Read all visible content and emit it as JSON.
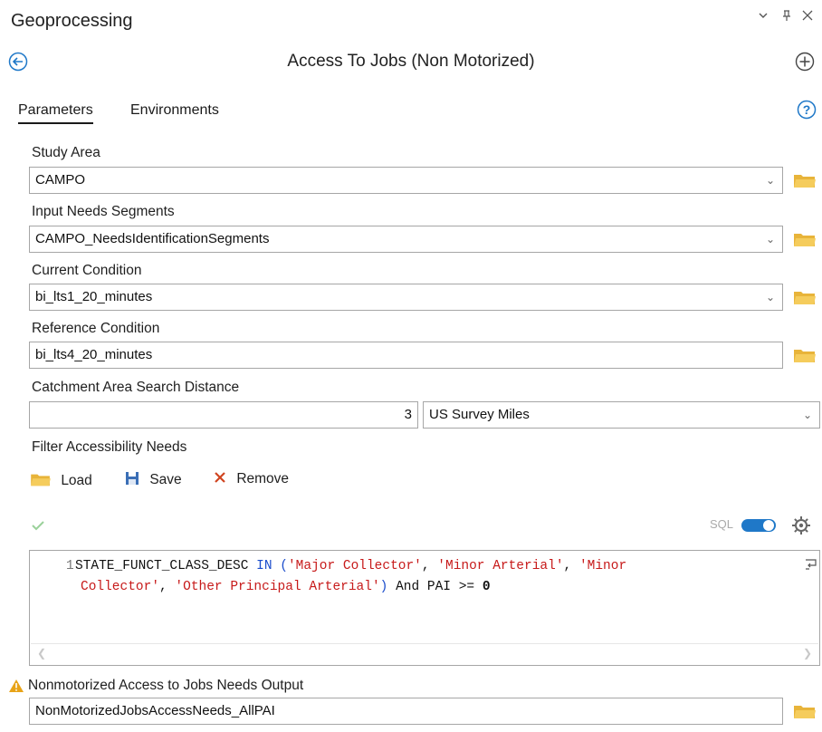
{
  "header": {
    "title": "Geoprocessing",
    "tool_name": "Access To Jobs (Non Motorized)"
  },
  "tabs": {
    "parameters": "Parameters",
    "environments": "Environments"
  },
  "fields": {
    "study_area": {
      "label": "Study Area",
      "value": "CAMPO"
    },
    "input_needs_segments": {
      "label": "Input Needs Segments",
      "value": "CAMPO_NeedsIdentificationSegments"
    },
    "current_condition": {
      "label": "Current Condition",
      "value": "bi_lts1_20_minutes"
    },
    "reference_condition": {
      "label": "Reference Condition",
      "value": "bi_lts4_20_minutes"
    },
    "catchment": {
      "label": "Catchment Area Search Distance",
      "value": "3",
      "unit": "US Survey Miles"
    },
    "filter": {
      "label": "Filter Accessibility Needs"
    },
    "output": {
      "label": "Nonmotorized Access to Jobs Needs Output",
      "value": "NonMotorizedJobsAccessNeeds_AllPAI"
    }
  },
  "filter_toolbar": {
    "load": "Load",
    "save": "Save",
    "remove": "Remove",
    "sql": "SQL"
  },
  "sql_editor": {
    "line_number": "1",
    "field": "STATE_FUNCT_CLASS_DESC",
    "op_in": " IN (",
    "v1": "'Major Collector'",
    "comma1": ", ",
    "v2": "'Minor Arterial'",
    "comma2": ", ",
    "v3a": "'Minor",
    "v3b": "Collector'",
    "comma3": ", ",
    "v4": "'Other Principal Arterial'",
    "close": ")",
    "and_kw": " And ",
    "field2": "PAI",
    "op_ge": " >= ",
    "num": "0"
  },
  "colors": {
    "accent": "#1f78c8",
    "folder": "#e8b43a",
    "warning": "#e8a317",
    "sql_string": "#c71a1a",
    "sql_keyword": "#1b4dcc"
  }
}
